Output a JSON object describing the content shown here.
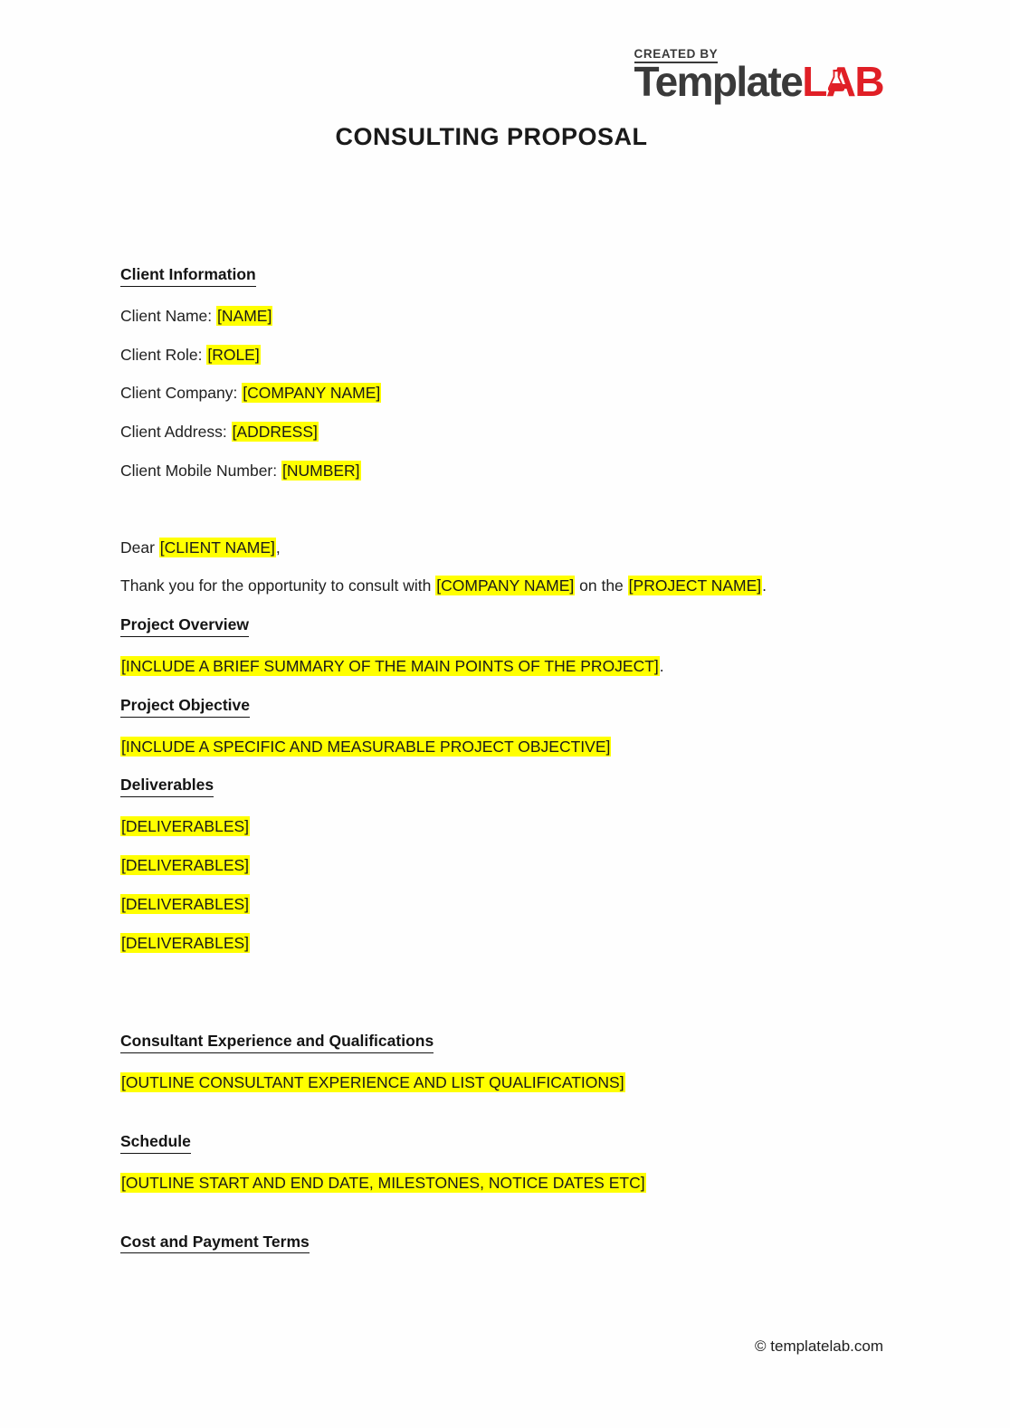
{
  "logo": {
    "created_by": "CREATED BY",
    "word_dark": "Template",
    "word_red": "LAB",
    "red_hex": "#E01F26",
    "dark_hex": "#3A3A3A",
    "icon": "flask-icon"
  },
  "document": {
    "title": "CONSULTING PROPOSAL",
    "highlight_hex": "#FFFF00",
    "footer": "© templatelab.com"
  },
  "sections": {
    "client_information": {
      "heading": "Client Information",
      "fields": [
        {
          "label": "Client Name: ",
          "value": "[NAME]"
        },
        {
          "label": "Client Role: ",
          "value": "[ROLE]"
        },
        {
          "label": "Client Company: ",
          "value": "[COMPANY NAME]"
        },
        {
          "label": "Client Address: ",
          "value": "[ADDRESS]"
        },
        {
          "label": "Client Mobile Number: ",
          "value": "[NUMBER]"
        }
      ]
    },
    "salutation": {
      "prefix": "Dear ",
      "value": "[CLIENT NAME]",
      "suffix": ","
    },
    "intro": {
      "part1": "Thank you for the opportunity to consult with ",
      "company": "[COMPANY NAME]",
      "part2": " on the ",
      "project": "[PROJECT NAME]",
      "part3": "."
    },
    "project_overview": {
      "heading": "Project Overview",
      "value": "[INCLUDE A BRIEF SUMMARY OF THE MAIN POINTS OF THE PROJECT]",
      "suffix": "."
    },
    "project_objective": {
      "heading": "Project Objective",
      "value": "[INCLUDE A SPECIFIC AND MEASURABLE PROJECT OBJECTIVE]"
    },
    "deliverables": {
      "heading": "Deliverables",
      "items": [
        "[DELIVERABLES]",
        "[DELIVERABLES]",
        "[DELIVERABLES]",
        "[DELIVERABLES]"
      ]
    },
    "consultant_experience": {
      "heading": "Consultant Experience and Qualifications",
      "value": "[OUTLINE CONSULTANT EXPERIENCE AND LIST QUALIFICATIONS]"
    },
    "schedule": {
      "heading": "Schedule",
      "value": "[OUTLINE START AND END DATE, MILESTONES, NOTICE DATES ETC]"
    },
    "cost_and_payment_terms": {
      "heading": "Cost and Payment Terms"
    }
  }
}
